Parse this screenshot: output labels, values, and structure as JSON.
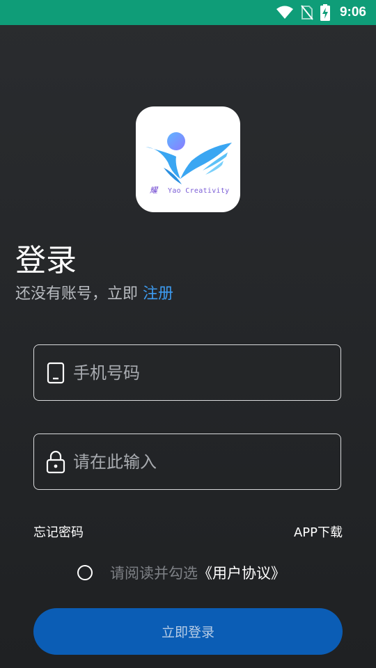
{
  "status_bar": {
    "time": "9:06",
    "icons": [
      "wifi-icon",
      "no-sim-icon",
      "battery-charging-icon"
    ],
    "background": "#0f9d78"
  },
  "logo": {
    "caption": "Yao Creativity"
  },
  "page": {
    "title": "登录",
    "subtitle_prefix": "还没有账号，立即 ",
    "register_link": "注册"
  },
  "form": {
    "phone_placeholder": "手机号码",
    "password_placeholder": "请在此输入"
  },
  "links": {
    "forgot_password": "忘记密码",
    "app_download": "APP下载"
  },
  "agreement": {
    "text": "请阅读并勾选",
    "link": "《用户协议》",
    "checked": false
  },
  "login_button": {
    "label": "立即登录",
    "color": "#0b5db5"
  }
}
